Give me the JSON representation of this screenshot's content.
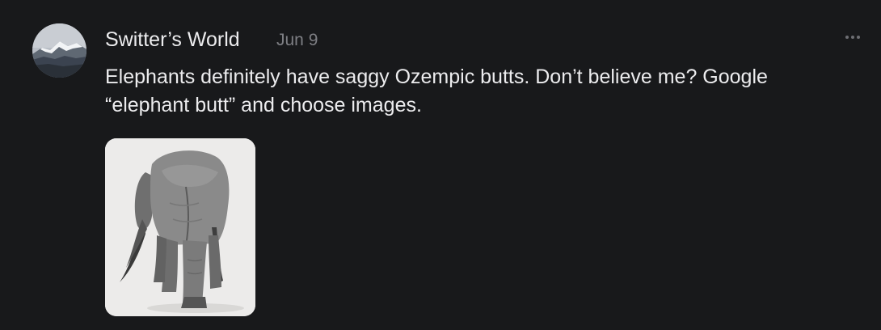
{
  "post": {
    "author": "Switter’s World",
    "date": "Jun 9",
    "text": "Elephants definitely have saggy Ozempic butts. Don’t believe me? Google “elephant butt” and choose images.",
    "avatar_icon": "mountain-landscape",
    "more_icon": "ellipsis-horizontal",
    "image_subject": "elephant-rear-view"
  },
  "colors": {
    "background": "#18191b",
    "text": "#ececee",
    "muted": "#7e7f84"
  }
}
